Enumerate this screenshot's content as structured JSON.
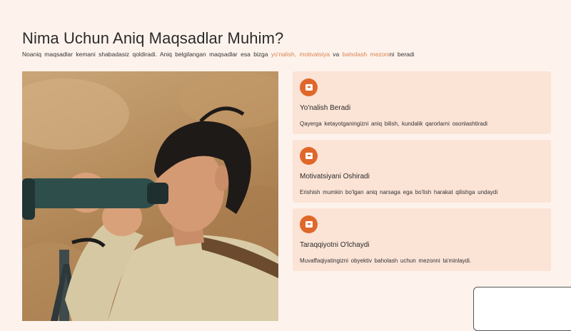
{
  "page": {
    "title": "Nima Uchun Aniq Maqsadlar Muhim?",
    "intro": {
      "part1": "Noaniq maqsadlar kemani shabadasiz qoldiradi. Aniq belgilangan maqsadlar esa bizga ",
      "highlight1": "yo'nalish, motivatsiya",
      "part2": " va ",
      "highlight2": "baholash mezoni",
      "part3": "ni beradi"
    }
  },
  "cards": [
    {
      "icon": "calendar-icon",
      "title": "Yo'nalish Beradi",
      "description": "Qayerga ketayotganingizni aniq bilish, kundalik qarorlarni osonlashtiradi"
    },
    {
      "icon": "calendar-icon",
      "title": "Motivatsiyani Oshiradi",
      "description": "Erishish mumkin bo'lgan aniq narsaga ega bo'lish harakat qilishga undaydi"
    },
    {
      "icon": "calendar-icon",
      "title": "Taraqqiyotni O'lchaydi",
      "description": "Muvaffaqiyatingizni obyektiv baholash uchun mezonni ta'minlaydi."
    }
  ],
  "colors": {
    "background": "#fdf3ec",
    "accent": "#e0672a",
    "highlight_text": "#d9824f",
    "card_bg": "#fbe3d6"
  }
}
